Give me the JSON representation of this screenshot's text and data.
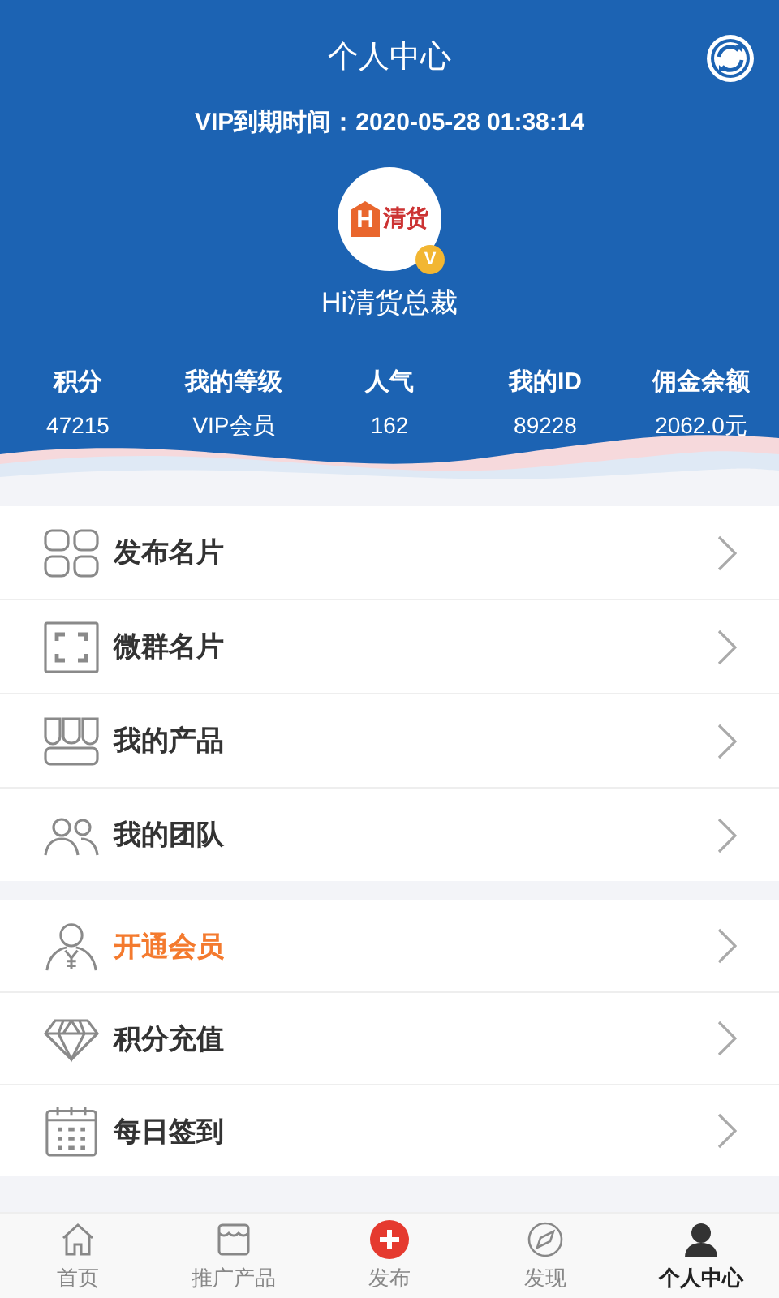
{
  "header": {
    "title": "个人中心",
    "vip_expiry": "VIP到期时间：2020-05-28 01:38:14",
    "avatar": {
      "logo_letter": "H",
      "logo_text": "清货",
      "badge": "V"
    },
    "name": "Hi清货总裁"
  },
  "stats": [
    {
      "label": "积分",
      "value": "47215"
    },
    {
      "label": "我的等级",
      "value": "VIP会员"
    },
    {
      "label": "人气",
      "value": "162"
    },
    {
      "label": "我的ID",
      "value": "89228"
    },
    {
      "label": "佣金余额",
      "value": "2062.0元"
    }
  ],
  "menu_groups": [
    [
      {
        "kind": "grid",
        "label": "发布名片",
        "highlighted": false
      },
      {
        "kind": "scan",
        "label": "微群名片",
        "highlighted": false
      },
      {
        "kind": "products",
        "label": "我的产品",
        "highlighted": false
      },
      {
        "kind": "team",
        "label": "我的团队",
        "highlighted": false
      }
    ],
    [
      {
        "kind": "member",
        "label": "开通会员",
        "highlighted": true
      },
      {
        "kind": "diamond",
        "label": "积分充值",
        "highlighted": false
      },
      {
        "kind": "calendar",
        "label": "每日签到",
        "highlighted": false
      }
    ]
  ],
  "tab_bar": [
    {
      "kind": "home",
      "label": "首页",
      "selected": false
    },
    {
      "kind": "store",
      "label": "推广产品",
      "selected": false
    },
    {
      "kind": "publish",
      "label": "发布",
      "selected": false
    },
    {
      "kind": "compass",
      "label": "发现",
      "selected": false
    },
    {
      "kind": "person",
      "label": "个人中心",
      "selected": true
    }
  ]
}
